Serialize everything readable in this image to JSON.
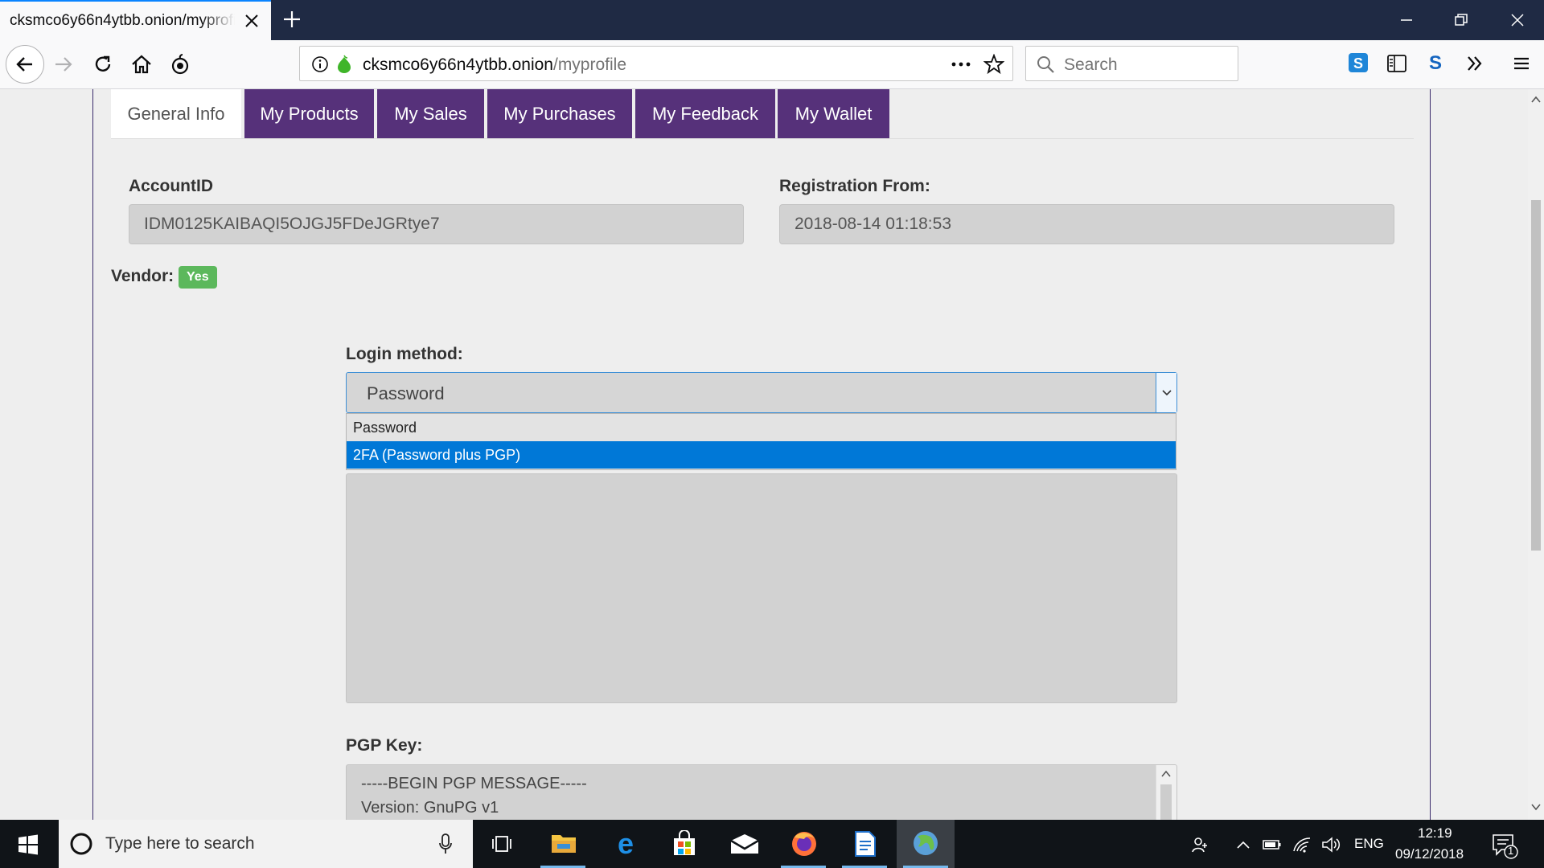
{
  "browser": {
    "tab": {
      "title": "cksmco6y66n4ytbb.onion/myprofile"
    },
    "url": {
      "host": "cksmco6y66n4ytbb.onion",
      "path": "/myprofile"
    },
    "search": {
      "placeholder": "Search"
    },
    "icons": {
      "nav": [
        "back-arrow-icon",
        "forward-arrow-icon",
        "reload-icon",
        "home-icon",
        "tor-onion-icon"
      ],
      "url": [
        "info-icon",
        "onion-secure-icon",
        "page-actions-icon",
        "bookmark-star-icon"
      ],
      "toolbar": [
        "skype-extension-icon",
        "reader-sidebar-icon",
        "extension-s-icon",
        "overflow-chevrons-icon",
        "hamburger-menu-icon"
      ]
    }
  },
  "profile": {
    "tabs": [
      {
        "label": "General Info",
        "active": true
      },
      {
        "label": "My Products"
      },
      {
        "label": "My Sales"
      },
      {
        "label": "My Purchases"
      },
      {
        "label": "My Feedback"
      },
      {
        "label": "My Wallet"
      }
    ],
    "account_id": {
      "label": "AccountID",
      "value": "IDM0125KAIBAQI5OJGJ5FDeJGRtye7"
    },
    "registration": {
      "label": "Registration From:",
      "value": "2018-08-14 01:18:53"
    },
    "vendor": {
      "label": "Vendor:",
      "badge": "Yes",
      "badge_color": "#5cb85c"
    },
    "login_method": {
      "label": "Login method:",
      "selected": "Password",
      "options": [
        "Password",
        "2FA (Password plus PGP)"
      ],
      "highlighted_option": "2FA (Password plus PGP)"
    },
    "pgp_key": {
      "label": "PGP Key:",
      "lines": [
        "-----BEGIN PGP MESSAGE-----",
        "Version: GnuPG v1"
      ]
    }
  },
  "taskbar": {
    "search_placeholder": "Type here to search",
    "apps": [
      "task-view-icon",
      "file-explorer-icon",
      "edge-icon",
      "store-icon",
      "mail-icon",
      "firefox-icon",
      "document-icon",
      "tor-browser-icon"
    ],
    "language": "ENG",
    "time": "12:19",
    "date": "09/12/2018",
    "notification_count": "1"
  },
  "colors": {
    "titlebar": "#1f2a44",
    "tab_purple": "#56317a",
    "accent_blue": "#0078d7",
    "badge_green": "#5cb85c"
  }
}
